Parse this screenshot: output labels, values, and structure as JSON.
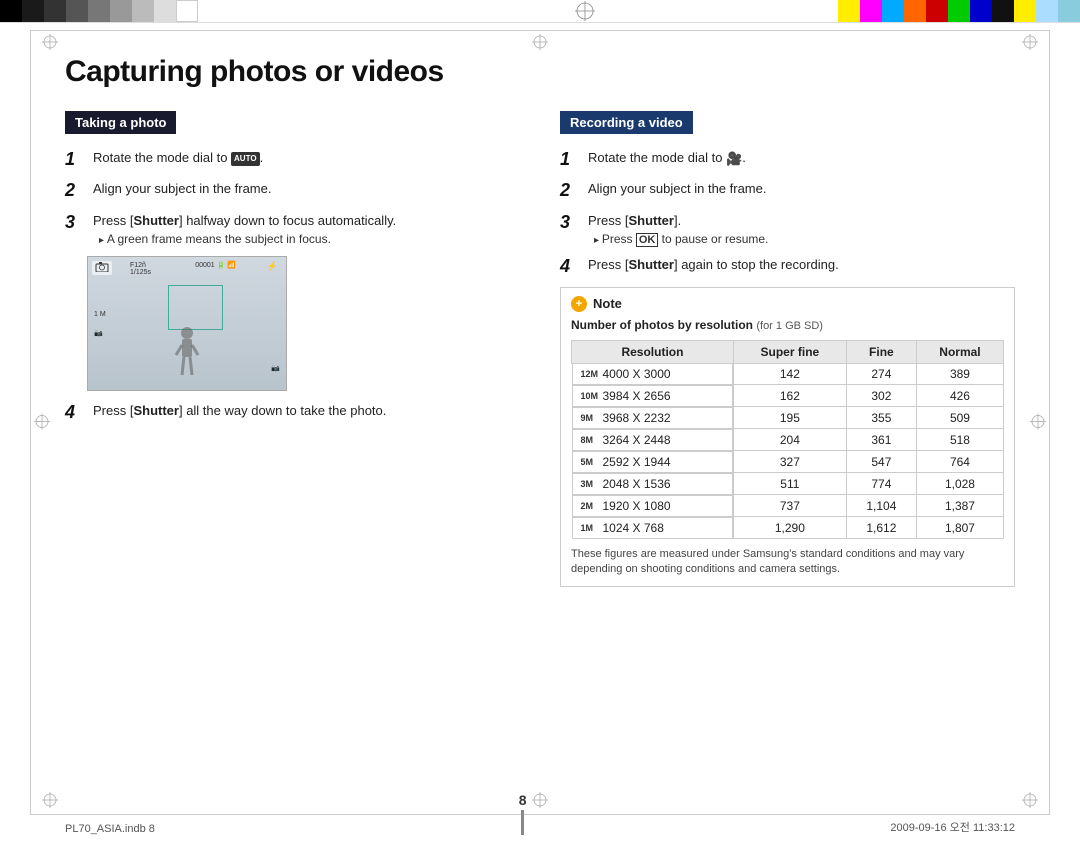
{
  "page": {
    "title": "Capturing photos or videos",
    "number": "8",
    "footer_left": "PL70_ASIA.indb   8",
    "footer_right": "2009-09-16   오전 11:33:12"
  },
  "left_section": {
    "header": "Taking a photo",
    "steps": [
      {
        "num": "1",
        "text": "Rotate the mode dial to ",
        "icon": "AUTO",
        "suffix": "."
      },
      {
        "num": "2",
        "text": "Align your subject in the frame."
      },
      {
        "num": "3",
        "text": "Press [Shutter] halfway down to focus automatically.",
        "bullet": "A green frame means the subject in focus."
      },
      {
        "num": "4",
        "text": "Press [Shutter] all the way down to take the photo."
      }
    ]
  },
  "right_section": {
    "header": "Recording a video",
    "steps": [
      {
        "num": "1",
        "text": "Rotate the mode dial to ",
        "icon": "video",
        "suffix": "."
      },
      {
        "num": "2",
        "text": "Align your subject in the frame."
      },
      {
        "num": "3",
        "text": "Press [Shutter].",
        "bullet": "Press [OK] to pause or resume."
      },
      {
        "num": "4",
        "text": "Press [Shutter] again to stop the recording."
      }
    ],
    "note": {
      "title": "Note",
      "subtitle": "Number of photos by resolution",
      "subtitle_detail": "(for 1 GB SD)",
      "table": {
        "headers": [
          "Resolution",
          "Super fine",
          "Fine",
          "Normal"
        ],
        "rows": [
          {
            "badge": "12M",
            "res": "4000 X 3000",
            "sf": "142",
            "f": "274",
            "n": "389"
          },
          {
            "badge": "10M",
            "res": "3984 X 2656",
            "sf": "162",
            "f": "302",
            "n": "426"
          },
          {
            "badge": "9M",
            "res": "3968 X 2232",
            "sf": "195",
            "f": "355",
            "n": "509"
          },
          {
            "badge": "8M",
            "res": "3264 X 2448",
            "sf": "204",
            "f": "361",
            "n": "518"
          },
          {
            "badge": "5M",
            "res": "2592 X 1944",
            "sf": "327",
            "f": "547",
            "n": "764"
          },
          {
            "badge": "3M",
            "res": "2048 X 1536",
            "sf": "511",
            "f": "774",
            "n": "1,028"
          },
          {
            "badge": "2M",
            "res": "1920 X 1080",
            "sf": "737",
            "f": "1,104",
            "n": "1,387"
          },
          {
            "badge": "1M",
            "res": "1024 X 768",
            "sf": "1,290",
            "f": "1,612",
            "n": "1,807"
          }
        ]
      },
      "table_note": "These figures are measured under Samsung's standard conditions and may vary depending on shooting conditions and camera settings."
    }
  },
  "colors": {
    "header_bg": "#1a1a2e",
    "note_icon_bg": "#f5a500",
    "accent": "#4a9966"
  }
}
